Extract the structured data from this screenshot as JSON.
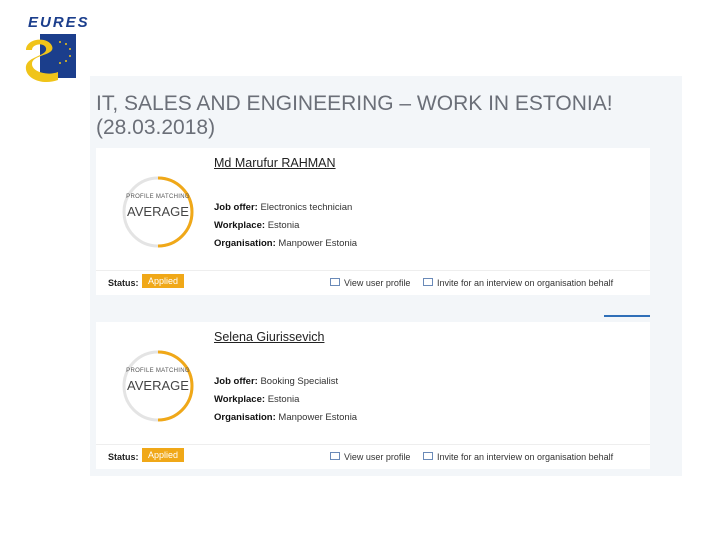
{
  "logo": {
    "text": "EURES"
  },
  "page": {
    "title": "IT, SALES AND ENGINEERING – WORK IN ESTONIA! (28.03.2018)"
  },
  "colors": {
    "accent": "#f0a818",
    "brand_blue": "#1b3e8c",
    "title_gray": "#6b6f78"
  },
  "candidates": [
    {
      "name": "Md Marufur RAHMAN",
      "gauge_label": "PROFILE MATCHING",
      "gauge_value": "AVERAGE",
      "job_offer_label": "Job offer:",
      "job_offer": "Electronics technician",
      "workplace_label": "Workplace:",
      "workplace": "Estonia",
      "organisation_label": "Organisation:",
      "organisation": "Manpower Estonia",
      "status_label": "Status:",
      "status": "Applied",
      "view_profile": "View user profile",
      "invite": "Invite for an interview on organisation behalf"
    },
    {
      "name": "Selena Giurissevich",
      "gauge_label": "PROFILE MATCHING",
      "gauge_value": "AVERAGE",
      "job_offer_label": "Job offer:",
      "job_offer": "Booking Specialist",
      "workplace_label": "Workplace:",
      "workplace": "Estonia",
      "organisation_label": "Organisation:",
      "organisation": "Manpower Estonia",
      "status_label": "Status:",
      "status": "Applied",
      "view_profile": "View user profile",
      "invite": "Invite for an interview on organisation behalf"
    }
  ]
}
